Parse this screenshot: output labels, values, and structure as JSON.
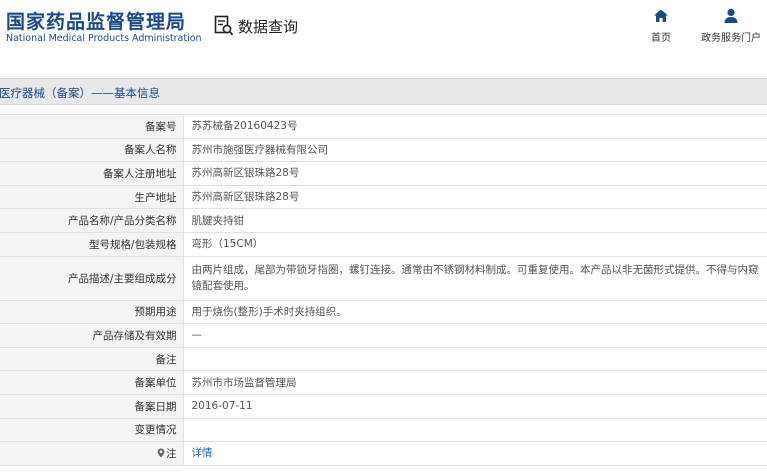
{
  "header": {
    "logo_cn": "国家药品监督管理局",
    "logo_en": "National Medical Products Administration",
    "query_label": "数据查询",
    "nav": [
      {
        "label": "首页",
        "icon": "home-icon"
      },
      {
        "label": "政务服务门户",
        "icon": "user-icon"
      }
    ]
  },
  "title": "医疗器械（备案）——基本信息",
  "rows": [
    {
      "label": "备案号",
      "value": "苏苏械备20160423号"
    },
    {
      "label": "备案人名称",
      "value": "苏州市施强医疗器械有限公司"
    },
    {
      "label": "备案人注册地址",
      "value": "苏州高新区银珠路28号"
    },
    {
      "label": "生产地址",
      "value": "苏州高新区银珠路28号"
    },
    {
      "label": "产品名称/产品分类名称",
      "value": "肌腱夹持钳"
    },
    {
      "label": "型号规格/包装规格",
      "value": "弯形（15CM）"
    },
    {
      "label": "产品描述/主要组成成分",
      "value": "由两片组成，尾部为带锁牙指圈，螺钉连接。通常由不锈钢材料制成。可重复使用。本产品以非无菌形式提供。不得与内窥镜配套使用。"
    },
    {
      "label": "预期用途",
      "value": "用于烧伤(整形)手术时夹持组织。"
    },
    {
      "label": "产品存储及有效期",
      "value": "—"
    },
    {
      "label": "备注",
      "value": ""
    },
    {
      "label": "备案单位",
      "value": "苏州市市场监督管理局"
    },
    {
      "label": "备案日期",
      "value": "2016-07-11"
    },
    {
      "label": "变更情况",
      "value": ""
    },
    {
      "label": "注",
      "value": "详情"
    }
  ],
  "colors": {
    "brand": "#1a4a8a",
    "link": "#1a6ab8",
    "label_bg": "#f4f4f4",
    "title_bg": "#e8e8e8"
  }
}
